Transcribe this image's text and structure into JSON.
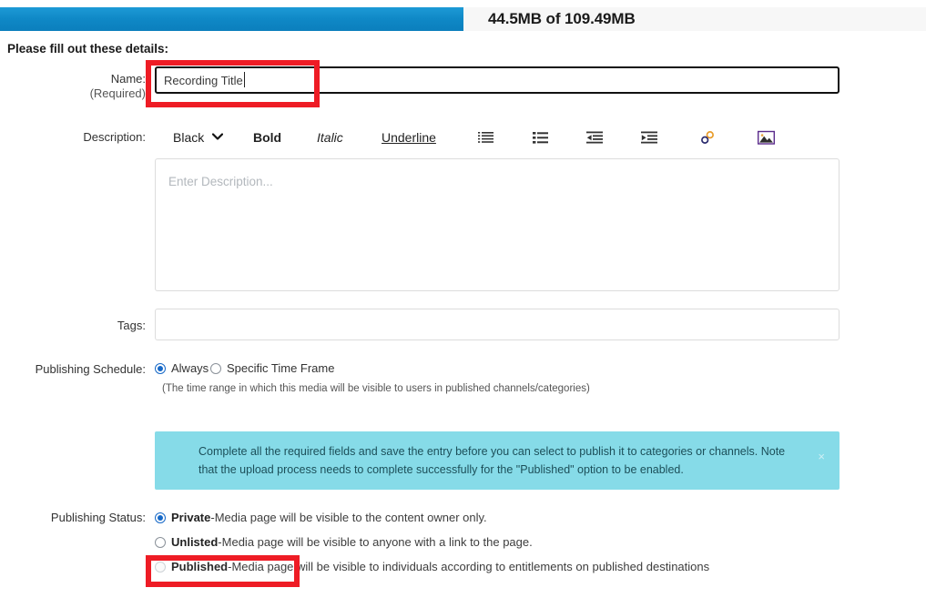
{
  "upload": {
    "progress_label": "44.5MB of 109.49MB",
    "uploaded": "44.5MB",
    "total": "109.49MB",
    "percent": 50,
    "fill_color": "#0f88c6",
    "track_color": "#f7f7f7"
  },
  "headline": "Please fill out these details:",
  "name_field": {
    "label": "Name:",
    "sublabel": "(Required)",
    "value": "Recording Title",
    "placeholder": ""
  },
  "description": {
    "label": "Description:",
    "placeholder": "Enter Description...",
    "value": "",
    "toolbar": {
      "color_label": "Black",
      "chevron": "chevron-down-icon",
      "bold_label": "Bold",
      "italic_label": "Italic",
      "underline_label": "Underline",
      "icons": [
        "ordered-list-icon",
        "unordered-list-icon",
        "outdent-icon",
        "indent-icon",
        "link-icon",
        "image-icon"
      ]
    }
  },
  "tags": {
    "label": "Tags:",
    "value": "",
    "placeholder": ""
  },
  "publishing_schedule": {
    "label": "Publishing Schedule:",
    "options": [
      {
        "label": "Always",
        "checked": true
      },
      {
        "label": "Specific Time Frame",
        "checked": false
      }
    ],
    "hint": "(The time range in which this media will be visible to users in published channels/categories)"
  },
  "alert": {
    "text": "Complete all the required fields and save the entry before you can select to publish it to categories or channels. Note that the upload process needs to complete successfully for the \"Published\" option to be enabled.",
    "close_label": "×",
    "background": "#86dbe8"
  },
  "publishing_status": {
    "label": "Publishing Status:",
    "options": [
      {
        "name": "Private",
        "separator": " - ",
        "description": "Media page will be visible to the content owner only.",
        "checked": true,
        "disabled": false
      },
      {
        "name": "Unlisted",
        "separator": " - ",
        "description": "Media page will be visible to anyone with a link to the page.",
        "checked": false,
        "disabled": false
      },
      {
        "name": "Published",
        "separator": " - ",
        "description": "Media page will be visible to individuals according to entitlements on published destinations",
        "checked": false,
        "disabled": true
      }
    ]
  },
  "annotations": {
    "color": "#ee1c25",
    "boxes": [
      "name-field-highlight",
      "published-option-highlight"
    ]
  }
}
